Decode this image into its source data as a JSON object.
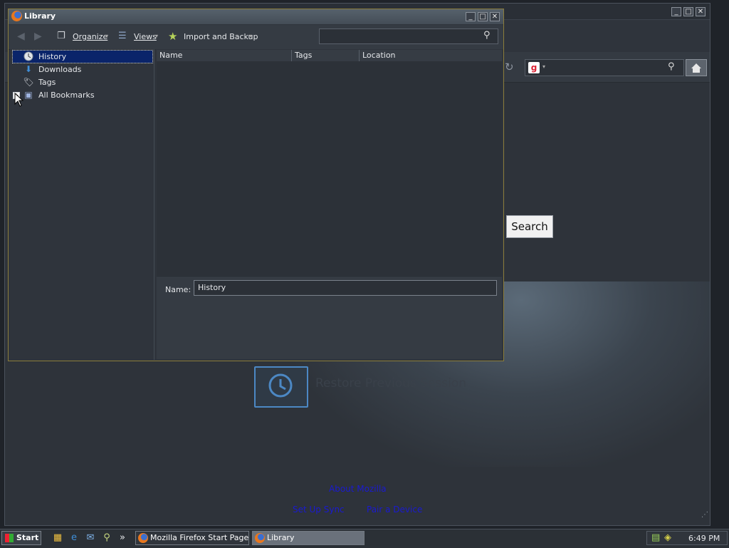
{
  "firefox": {
    "window_controls": {
      "minimize": "_",
      "maximize": "□",
      "close": "✕"
    },
    "search_button": "Search",
    "restore_session": "Restore Previous Session",
    "links": {
      "about": "About Mozilla",
      "sync": "Set Up Sync",
      "pair": "Pair a Device"
    }
  },
  "library": {
    "title": "Library",
    "window_controls": {
      "minimize": "_",
      "maximize": "□",
      "close": "✕"
    },
    "toolbar": {
      "organize": "Organize",
      "views": "Views",
      "import_backup": "Import and Backup",
      "search_placeholder": ""
    },
    "sidebar": {
      "items": [
        {
          "label": "History",
          "icon": "clock-icon",
          "selected": true
        },
        {
          "label": "Downloads",
          "icon": "download-arrow-icon"
        },
        {
          "label": "Tags",
          "icon": "tag-icon"
        },
        {
          "label": "All Bookmarks",
          "icon": "bookmark-star-icon",
          "expandable": true
        }
      ]
    },
    "columns": [
      "Name",
      "Tags",
      "Location"
    ],
    "details": {
      "name_label": "Name:",
      "name_value": "History"
    }
  },
  "taskbar": {
    "start": "Start",
    "more": "»",
    "tasks": [
      {
        "label": "Mozilla Firefox Start Page...",
        "icon": "firefox-icon"
      },
      {
        "label": "Library",
        "icon": "firefox-icon",
        "active": true
      }
    ],
    "clock": "6:49 PM"
  },
  "colors": {
    "accent_selection": "#0a246a",
    "link": "#1a1ad0",
    "restore_tile_border": "#4c88c4"
  }
}
